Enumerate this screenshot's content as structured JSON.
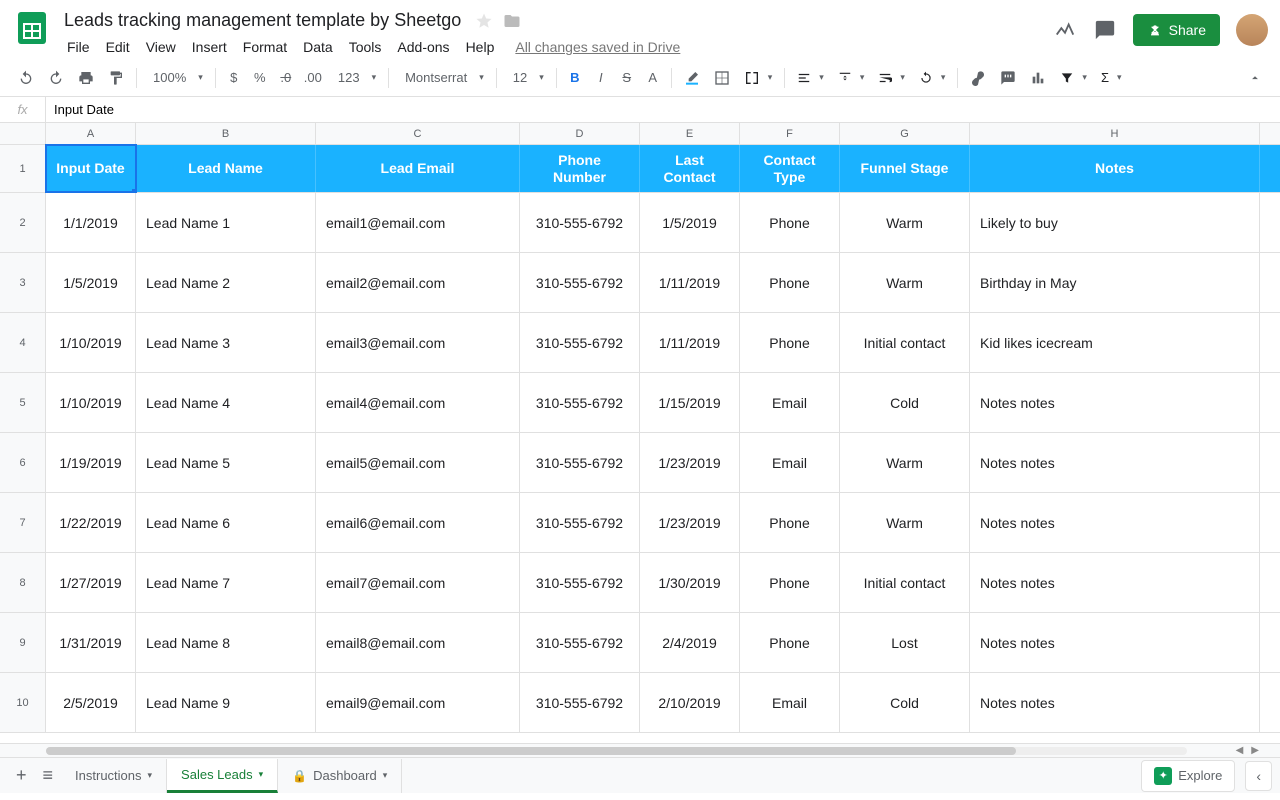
{
  "doc_title": "Leads tracking management template by Sheetgo",
  "saved_text": "All changes saved in Drive",
  "menu": [
    "File",
    "Edit",
    "View",
    "Insert",
    "Format",
    "Data",
    "Tools",
    "Add-ons",
    "Help"
  ],
  "share_label": "Share",
  "toolbar": {
    "zoom": "100%",
    "currency": "$",
    "percent": "%",
    "dec_dec": ".0",
    "inc_dec": ".00",
    "num_fmt": "123",
    "font": "Montserrat",
    "font_size": "12"
  },
  "formula_bar_value": "Input Date",
  "columns": [
    "A",
    "B",
    "C",
    "D",
    "E",
    "F",
    "G",
    "H"
  ],
  "header_row": [
    "Input Date",
    "Lead Name",
    "Lead Email",
    "Phone Number",
    "Last Contact",
    "Contact Type",
    "Funnel Stage",
    "Notes"
  ],
  "rows": [
    [
      "1/1/2019",
      "Lead Name 1",
      "email1@email.com",
      "310-555-6792",
      "1/5/2019",
      "Phone",
      "Warm",
      "Likely to buy"
    ],
    [
      "1/5/2019",
      "Lead Name 2",
      "email2@email.com",
      "310-555-6792",
      "1/11/2019",
      "Phone",
      "Warm",
      "Birthday in May"
    ],
    [
      "1/10/2019",
      "Lead Name 3",
      "email3@email.com",
      "310-555-6792",
      "1/11/2019",
      "Phone",
      "Initial contact",
      "Kid likes icecream"
    ],
    [
      "1/10/2019",
      "Lead Name 4",
      "email4@email.com",
      "310-555-6792",
      "1/15/2019",
      "Email",
      "Cold",
      "Notes notes"
    ],
    [
      "1/19/2019",
      "Lead Name 5",
      "email5@email.com",
      "310-555-6792",
      "1/23/2019",
      "Email",
      "Warm",
      "Notes notes"
    ],
    [
      "1/22/2019",
      "Lead Name 6",
      "email6@email.com",
      "310-555-6792",
      "1/23/2019",
      "Phone",
      "Warm",
      "Notes notes"
    ],
    [
      "1/27/2019",
      "Lead Name 7",
      "email7@email.com",
      "310-555-6792",
      "1/30/2019",
      "Phone",
      "Initial contact",
      "Notes notes"
    ],
    [
      "1/31/2019",
      "Lead Name 8",
      "email8@email.com",
      "310-555-6792",
      "2/4/2019",
      "Phone",
      "Lost",
      "Notes notes"
    ],
    [
      "2/5/2019",
      "Lead Name 9",
      "email9@email.com",
      "310-555-6792",
      "2/10/2019",
      "Email",
      "Cold",
      "Notes notes"
    ]
  ],
  "row_numbers": [
    "1",
    "2",
    "3",
    "4",
    "5",
    "6",
    "7",
    "8",
    "9",
    "10"
  ],
  "sheet_tabs": [
    {
      "name": "Instructions",
      "locked": false,
      "active": false
    },
    {
      "name": "Sales Leads",
      "locked": false,
      "active": true
    },
    {
      "name": "Dashboard",
      "locked": true,
      "active": false
    }
  ],
  "explore_label": "Explore"
}
